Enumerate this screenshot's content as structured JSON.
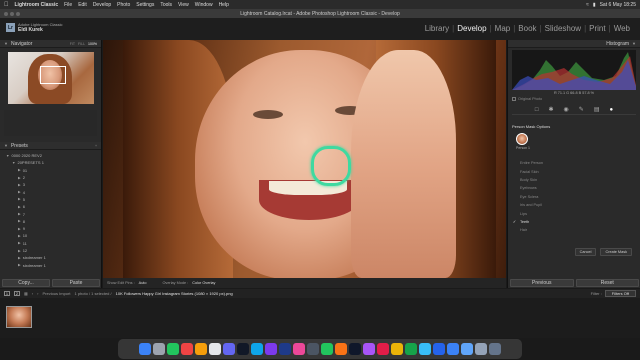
{
  "menubar": {
    "app": "Lightroom Classic",
    "items": [
      "File",
      "Edit",
      "Develop",
      "Photo",
      "Settings",
      "Tools",
      "View",
      "Window",
      "Help"
    ],
    "clock": "Sat 6 May 18:25"
  },
  "window": {
    "title": "Lightroom Catalog.lrcat - Adobe Photoshop Lightroom Classic - Develop"
  },
  "identity": {
    "caption": "Adobe Lightroom Classic",
    "user": "Eldi Kurek"
  },
  "modules": [
    "Library",
    "Develop",
    "Map",
    "Book",
    "Slideshow",
    "Print",
    "Web"
  ],
  "active_module": "Develop",
  "navigator": {
    "title": "Navigator",
    "zoom_options": [
      "FIT",
      "FILL",
      "100%"
    ],
    "active_zoom": "100%"
  },
  "presets": {
    "title": "Presets",
    "rows": [
      {
        "kind": "folder",
        "text": "0000 2020 REV2"
      },
      {
        "kind": "sub",
        "text": "20PRESETS 1"
      },
      {
        "kind": "item",
        "text": "01"
      },
      {
        "kind": "item",
        "text": "2"
      },
      {
        "kind": "item",
        "text": "3"
      },
      {
        "kind": "item",
        "text": "4"
      },
      {
        "kind": "item",
        "text": "5"
      },
      {
        "kind": "item",
        "text": "6"
      },
      {
        "kind": "item",
        "text": "7"
      },
      {
        "kind": "item",
        "text": "8"
      },
      {
        "kind": "item",
        "text": "9"
      },
      {
        "kind": "item",
        "text": "10"
      },
      {
        "kind": "item",
        "text": "11"
      },
      {
        "kind": "item",
        "text": "12"
      },
      {
        "kind": "item",
        "text": "sixdreamer 1"
      },
      {
        "kind": "item",
        "text": "sixdreamer 1"
      }
    ]
  },
  "left_buttons": {
    "copy": "Copy...",
    "paste": "Paste"
  },
  "toolbar": {
    "show_edit_pins_label": "Show Edit Pins :",
    "show_edit_pins_value": "Auto",
    "overlay_mode_label": "Overlay Mode :",
    "overlay_mode_value": "Color Overlay"
  },
  "histogram": {
    "title": "Histogram",
    "readout": "R  71.1   G  66.8   B  57.8 %",
    "original_photo": "Original Photo"
  },
  "mask_options": {
    "title": "Person Mask Options",
    "person_label": "Person 1",
    "parts": [
      {
        "label": "Entire Person",
        "checked": false
      },
      {
        "label": "Facial Skin",
        "checked": false
      },
      {
        "label": "Body Skin",
        "checked": false
      },
      {
        "label": "Eyebrows",
        "checked": false
      },
      {
        "label": "Eye Sclera",
        "checked": false
      },
      {
        "label": "Iris and Pupil",
        "checked": false
      },
      {
        "label": "Lips",
        "checked": false
      },
      {
        "label": "Teeth",
        "checked": true
      },
      {
        "label": "Hair",
        "checked": false
      }
    ],
    "cancel": "Cancel",
    "create": "Create Mask"
  },
  "right_buttons": {
    "previous": "Previous",
    "reset": "Reset"
  },
  "filmbar": {
    "page_a": "1",
    "page_b": "2",
    "source": "Previous Import",
    "count": "1 photo / 1 selected /",
    "filename": "10K Followers Happy Girl Instagram Stories (1080 × 1920 px).png",
    "filter_label": "Filter :",
    "filter_value": "Filters Off"
  },
  "dock_colors": [
    "#3b82f6",
    "#9ca3af",
    "#22c55e",
    "#ef4444",
    "#f59e0b",
    "#e5e7eb",
    "#6366f1",
    "#111827",
    "#0ea5e9",
    "#7c3aed",
    "#1e3a8a",
    "#ec4899",
    "#4b5563",
    "#22c55e",
    "#f97316",
    "#0f172a",
    "#a855f7",
    "#e11d48",
    "#eab308",
    "#16a34a",
    "#38bdf8",
    "#2563eb",
    "#3b82f6",
    "#60a5fa",
    "#94a3b8",
    "#64748b"
  ]
}
